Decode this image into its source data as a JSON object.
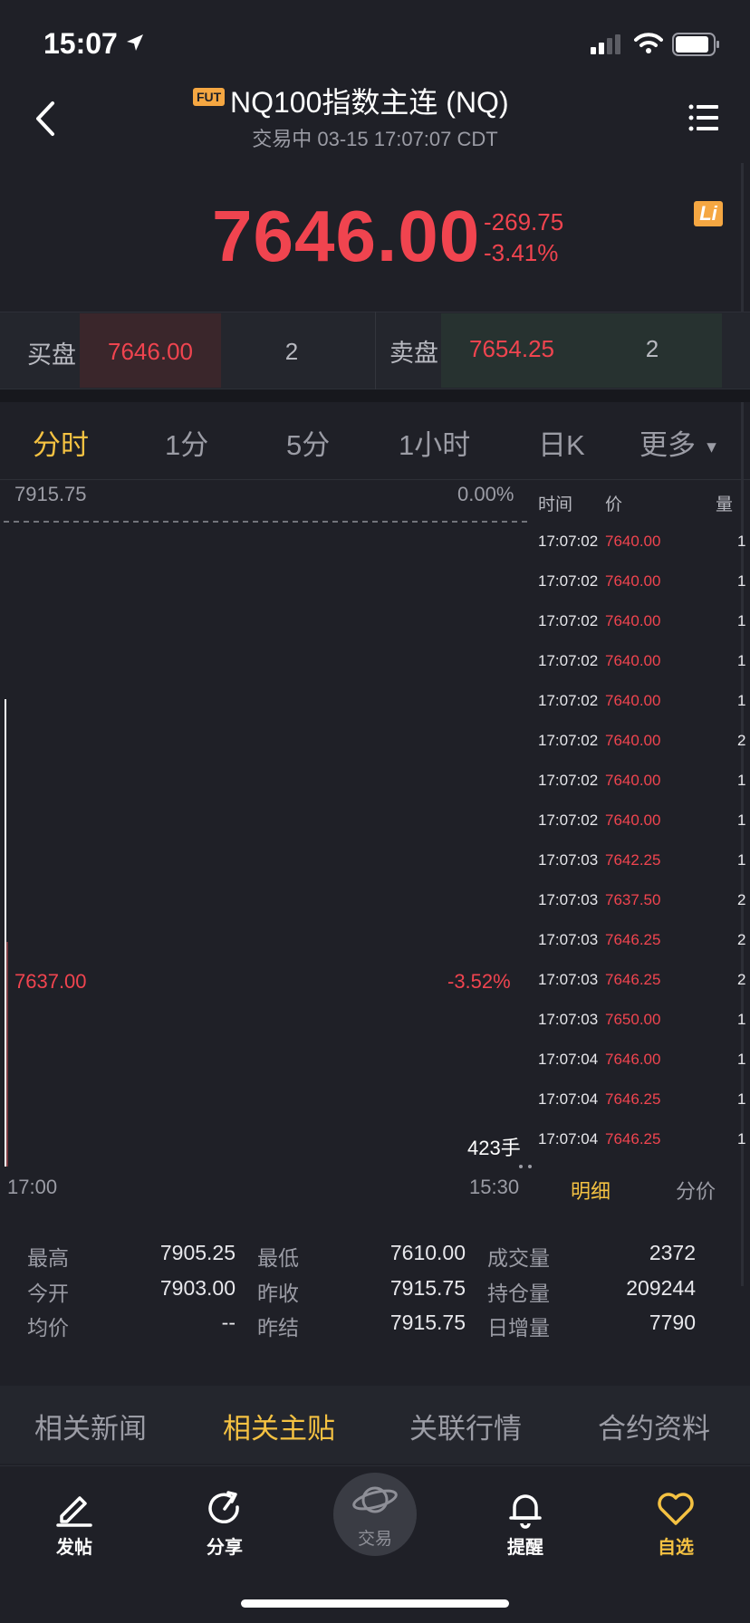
{
  "status_bar": {
    "time": "15:07"
  },
  "header": {
    "badge": "FUT",
    "title": "NQ100指数主连 (NQ)",
    "subtitle": "交易中 03-15 17:07:07 CDT",
    "li_badge": "Li"
  },
  "quote": {
    "price": "7646.00",
    "change": "-269.75",
    "change_pct": "-3.41%",
    "up_color": "#f0444f"
  },
  "order_book": {
    "bid_label": "买盘",
    "bid_price": "7646.00",
    "bid_size": "2",
    "ask_label": "卖盘",
    "ask_price": "7654.25",
    "ask_size": "2"
  },
  "tabs": [
    "分时",
    "1分",
    "5分",
    "1小时",
    "日K",
    "更多"
  ],
  "active_tab": "分时",
  "chart": {
    "high_price": "7915.75",
    "high_pct": "0.00%",
    "low_price": "7637.00",
    "low_pct": "-3.52%",
    "volume": "423手",
    "axis_start": "17:00",
    "axis_end": "15:30"
  },
  "ticks": {
    "headers": {
      "time": "时间",
      "price": "价",
      "volume": "量"
    },
    "rows": [
      {
        "time": "17:07:02",
        "price": "7640.00",
        "volume": "1"
      },
      {
        "time": "17:07:02",
        "price": "7640.00",
        "volume": "1"
      },
      {
        "time": "17:07:02",
        "price": "7640.00",
        "volume": "1"
      },
      {
        "time": "17:07:02",
        "price": "7640.00",
        "volume": "1"
      },
      {
        "time": "17:07:02",
        "price": "7640.00",
        "volume": "1"
      },
      {
        "time": "17:07:02",
        "price": "7640.00",
        "volume": "2"
      },
      {
        "time": "17:07:02",
        "price": "7640.00",
        "volume": "1"
      },
      {
        "time": "17:07:02",
        "price": "7640.00",
        "volume": "1"
      },
      {
        "time": "17:07:03",
        "price": "7642.25",
        "volume": "1"
      },
      {
        "time": "17:07:03",
        "price": "7637.50",
        "volume": "2"
      },
      {
        "time": "17:07:03",
        "price": "7646.25",
        "volume": "2"
      },
      {
        "time": "17:07:03",
        "price": "7646.25",
        "volume": "2"
      },
      {
        "time": "17:07:03",
        "price": "7650.00",
        "volume": "1"
      },
      {
        "time": "17:07:04",
        "price": "7646.00",
        "volume": "1"
      },
      {
        "time": "17:07:04",
        "price": "7646.25",
        "volume": "1"
      },
      {
        "time": "17:07:04",
        "price": "7646.25",
        "volume": "1"
      }
    ],
    "detail_tab": "明细",
    "split_tab": "分价"
  },
  "stats": {
    "high_label": "最高",
    "high": "7905.25",
    "low_label": "最低",
    "low": "7610.00",
    "volume_label": "成交量",
    "volume": "2372",
    "open_label": "今开",
    "open": "7903.00",
    "prev_close_label": "昨收",
    "prev_close": "7915.75",
    "oi_label": "持仓量",
    "oi": "209244",
    "avg_label": "均价",
    "avg": "--",
    "prev_settle_label": "昨结",
    "prev_settle": "7915.75",
    "daily_inc_label": "日增量",
    "daily_inc": "7790"
  },
  "section_tabs": [
    "相关新闻",
    "相关主贴",
    "关联行情",
    "合约资料"
  ],
  "active_section": "相关主贴",
  "bottom_nav": {
    "post": "发帖",
    "share": "分享",
    "trade": "交易",
    "alert": "提醒",
    "watchlist": "自选"
  },
  "colors": {
    "background": "#1f2027",
    "accent": "#f5c242",
    "down_red": "#f0444f",
    "badge_orange": "#f5a742"
  }
}
